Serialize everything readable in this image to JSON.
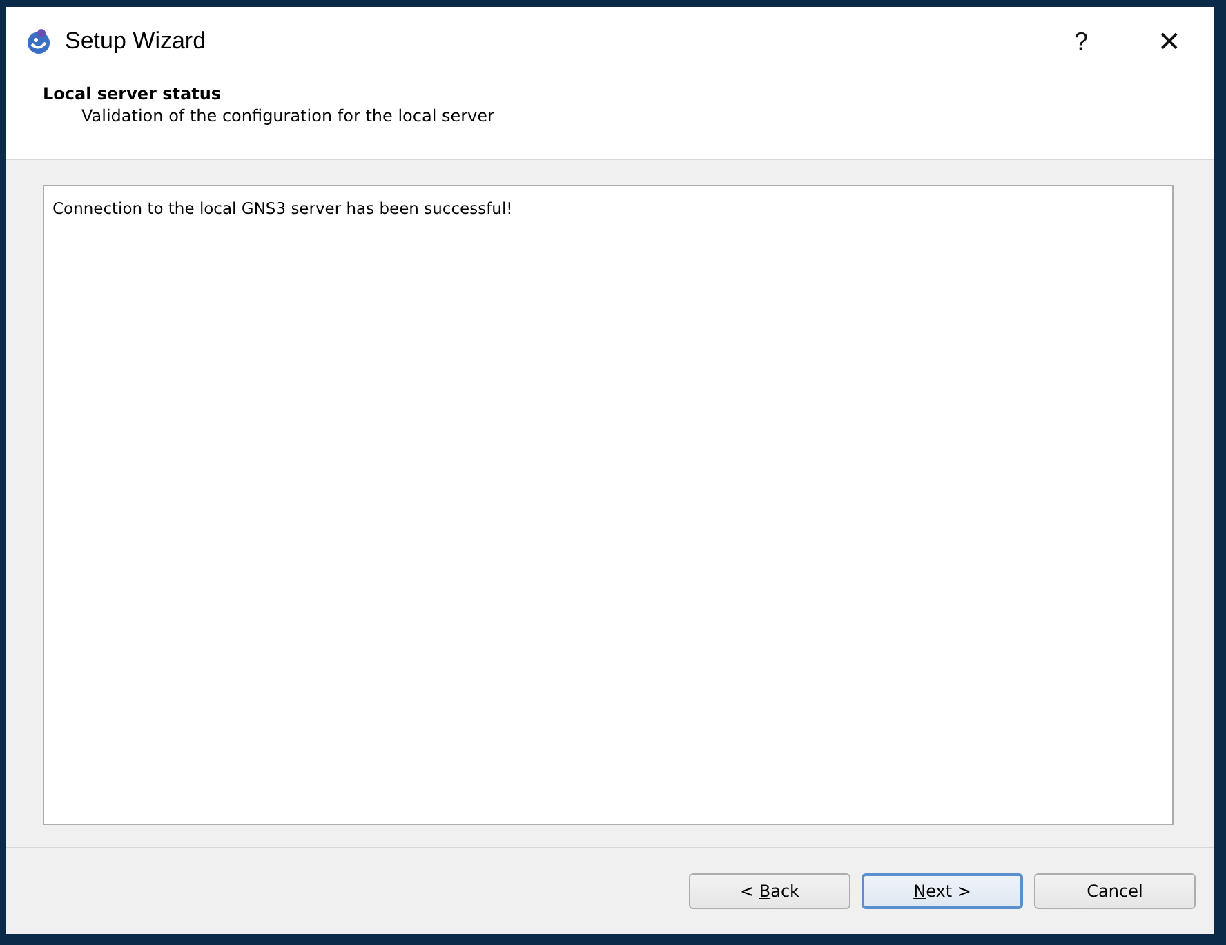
{
  "window": {
    "title": "Setup Wizard",
    "help": "?",
    "close": "✕"
  },
  "page": {
    "title": "Local server status",
    "subtitle": "Validation of the configuration for the local server"
  },
  "message": "Connection to the local GNS3 server has been successful!",
  "buttons": [
    {
      "before": "< ",
      "access_key": "B",
      "after": "ack",
      "default": false
    },
    {
      "access_key": "N",
      "after": "ext >",
      "default": true
    },
    {
      "before": "Cancel",
      "default": false
    }
  ]
}
